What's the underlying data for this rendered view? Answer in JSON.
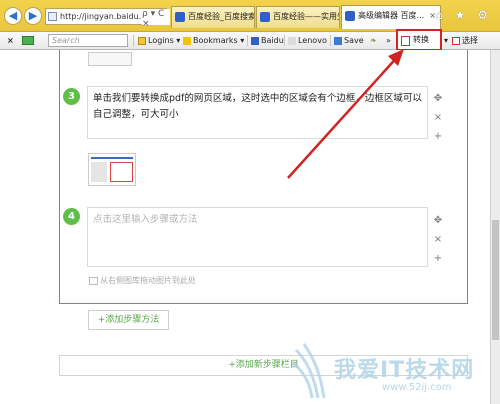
{
  "browser": {
    "address": "http://jingyan.baidu...",
    "address_tools": "ρ ▾ C ×",
    "tabs": [
      {
        "label": "百度经验_百度搜索",
        "close": ""
      },
      {
        "label": "百度经验——实用生...",
        "close": ""
      },
      {
        "label": "高级编辑器 百度...",
        "close": "×"
      }
    ],
    "window_icons": "⌂ ★ ⚙"
  },
  "toolbar": {
    "close": "×",
    "search_placeholder": "Search",
    "logins": "Logins ▾",
    "bookmarks": "Bookmarks ▾",
    "baidu": "Baidu",
    "lenovo": "Lenovo",
    "save": "Save",
    "more": "»",
    "convert": "转换",
    "convert_dropdown": "▾",
    "select": "选择"
  },
  "editor": {
    "steps": [
      {
        "number": "3",
        "text": "单击我们要转换成pdf的网页区域，这时选中的区域会有个边框，边框区域可以自己调整，可大可小"
      },
      {
        "number": "4",
        "placeholder": "点击这里输入步骤或方法"
      }
    ],
    "tools": {
      "move": "✥",
      "delete": "×",
      "add": "+"
    },
    "image_library_link": "从右侧图库拖动图片到此处",
    "add_step": "+添加步骤方法",
    "add_section": "+添加新步骤栏目"
  },
  "watermark": {
    "text": "我爱IT技术网",
    "url": "www.52ij.com"
  },
  "colors": {
    "accent_green": "#5fbe47",
    "highlight_red": "#d32222",
    "browser_frame": "#f3d24c"
  }
}
